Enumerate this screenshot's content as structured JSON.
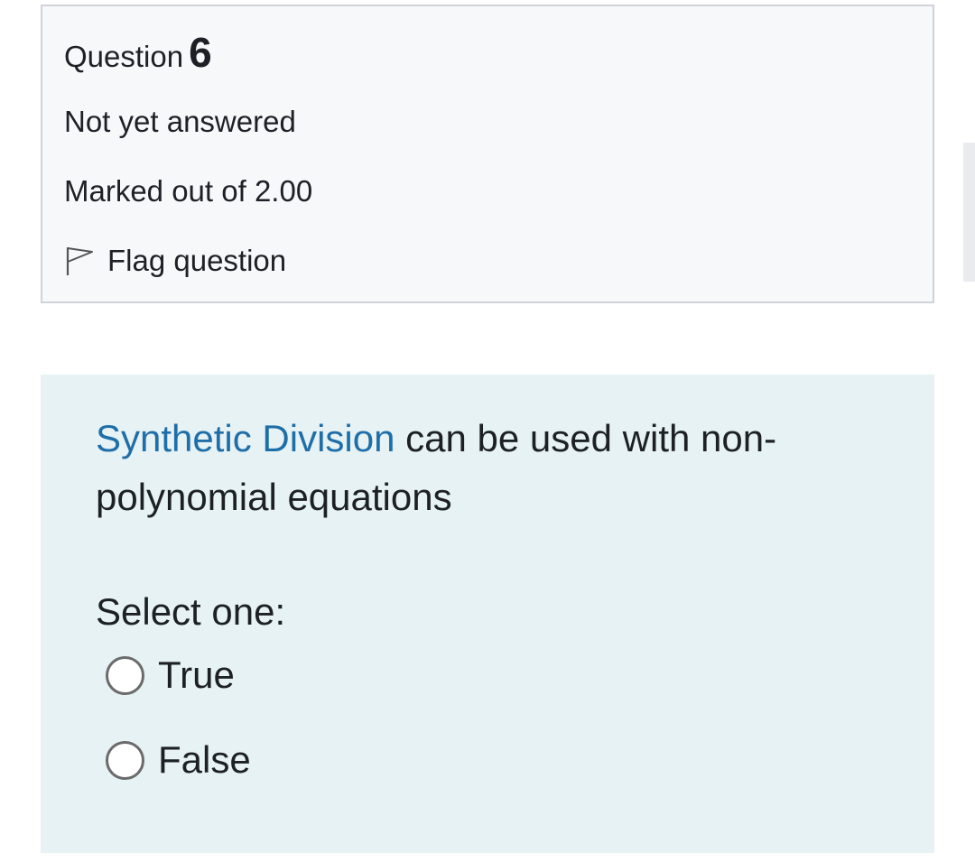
{
  "question_info": {
    "heading_label": "Question",
    "number": "6",
    "state": "Not yet answered",
    "grade": "Marked out of 2.00",
    "flag_label": "Flag question",
    "flag_icon": "flag-outline-icon"
  },
  "question": {
    "text_link": "Synthetic Division",
    "text_rest": " can be used with non-polynomial equations",
    "prompt": "Select one:",
    "options": [
      {
        "label": "True",
        "selected": false
      },
      {
        "label": "False",
        "selected": false
      }
    ]
  },
  "colors": {
    "info_bg": "#f7f8fa",
    "info_border": "#cfd3d8",
    "content_bg": "#e6f2f4",
    "link": "#1f6ea8",
    "text": "#1d2125"
  }
}
